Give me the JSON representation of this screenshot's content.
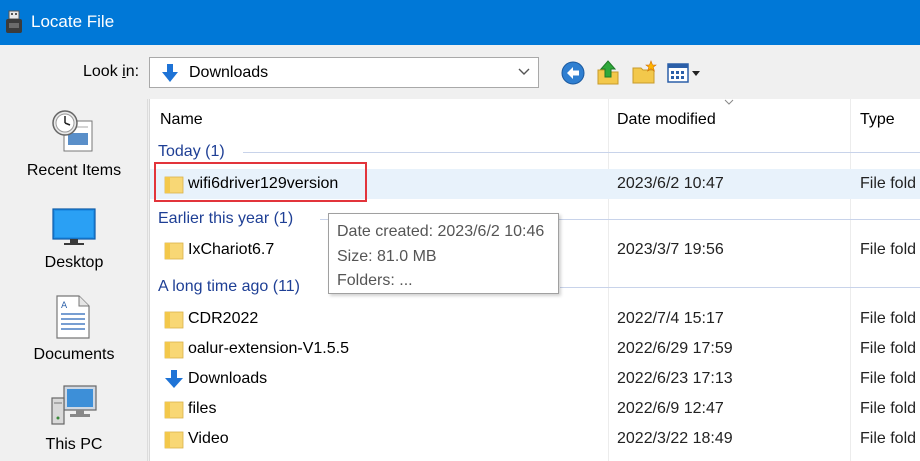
{
  "window": {
    "title": "Locate File",
    "app_icon": "usb-drive-icon"
  },
  "lookin": {
    "label_pre": "Look ",
    "label_accel": "i",
    "label_post": "n:",
    "value": "Downloads",
    "icon": "download-arrow-icon"
  },
  "toolbar": {
    "buttons": [
      "back-icon",
      "up-folder-icon",
      "new-folder-icon",
      "view-menu-icon"
    ]
  },
  "places": [
    {
      "label": "Recent Items",
      "icon": "recent-items-icon"
    },
    {
      "label": "Desktop",
      "icon": "desktop-icon"
    },
    {
      "label": "Documents",
      "icon": "documents-icon"
    },
    {
      "label": "This PC",
      "icon": "this-pc-icon"
    }
  ],
  "columns": {
    "name": "Name",
    "date": "Date modified",
    "type": "Type"
  },
  "groups": [
    {
      "label": "Today (1)"
    },
    {
      "label": "Earlier this year (1)"
    },
    {
      "label": "A long time ago (11)"
    }
  ],
  "files": [
    {
      "name": "wifi6driver129version",
      "date": "2023/6/2 10:47",
      "type": "File fold",
      "icon": "folder-icon",
      "selected": true
    },
    {
      "name": "IxChariot6.7",
      "date": "2023/3/7 19:56",
      "type": "File fold",
      "icon": "folder-icon"
    },
    {
      "name": "CDR2022",
      "date": "2022/7/4 15:17",
      "type": "File fold",
      "icon": "folder-icon"
    },
    {
      "name": "oalur-extension-V1.5.5",
      "date": "2022/6/29 17:59",
      "type": "File fold",
      "icon": "folder-icon"
    },
    {
      "name": "Downloads",
      "date": "2022/6/23 17:13",
      "type": "File fold",
      "icon": "download-arrow-icon"
    },
    {
      "name": "files",
      "date": "2022/6/9 12:47",
      "type": "File fold",
      "icon": "folder-icon"
    },
    {
      "name": "Video",
      "date": "2022/3/22 18:49",
      "type": "File fold",
      "icon": "folder-icon"
    }
  ],
  "tooltip": {
    "created": "Date created: 2023/6/2 10:46",
    "size": "Size: 81.0 MB",
    "folders": "Folders: ..."
  },
  "colors": {
    "titlebar": "#0078d7",
    "group_text": "#1e3f95",
    "highlight_box": "#e2343b",
    "folder": "#f8d775"
  }
}
